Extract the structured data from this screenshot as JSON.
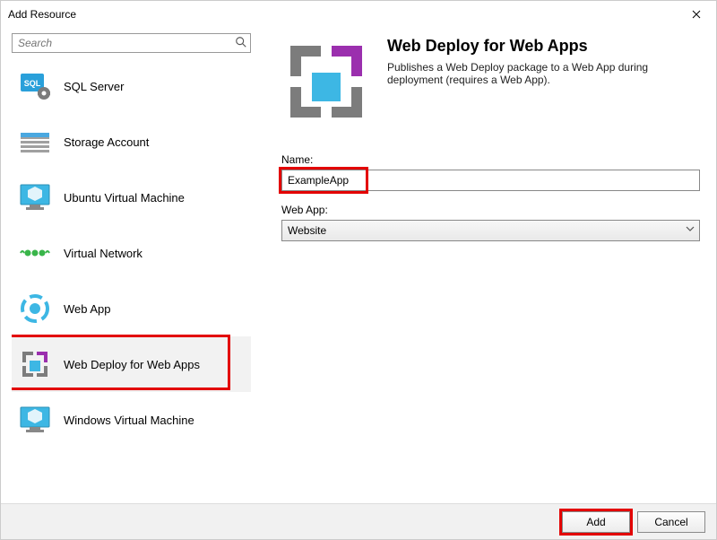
{
  "dialog": {
    "title": "Add Resource"
  },
  "search": {
    "placeholder": "Search"
  },
  "resources": {
    "items": [
      {
        "label": "SQL Server",
        "icon": "sql-server-icon"
      },
      {
        "label": "Storage Account",
        "icon": "storage-icon"
      },
      {
        "label": "Ubuntu Virtual Machine",
        "icon": "ubuntu-vm-icon"
      },
      {
        "label": "Virtual Network",
        "icon": "vnet-icon"
      },
      {
        "label": "Web App",
        "icon": "webapp-icon"
      },
      {
        "label": "Web Deploy for Web Apps",
        "icon": "webdeploy-icon"
      },
      {
        "label": "Windows Virtual Machine",
        "icon": "windows-vm-icon"
      }
    ],
    "selected_index": 5
  },
  "details": {
    "title": "Web Deploy for Web Apps",
    "description": "Publishes a Web Deploy package to a Web App during deployment (requires a Web App).",
    "name_label": "Name:",
    "name_value": "ExampleApp",
    "webapp_label": "Web App:",
    "webapp_value": "Website"
  },
  "footer": {
    "add_label": "Add",
    "cancel_label": "Cancel"
  },
  "colors": {
    "highlight": "#e30000",
    "accent_purple": "#9b2fae",
    "accent_blue": "#3db7e4",
    "accent_gray": "#7c7c7c"
  }
}
